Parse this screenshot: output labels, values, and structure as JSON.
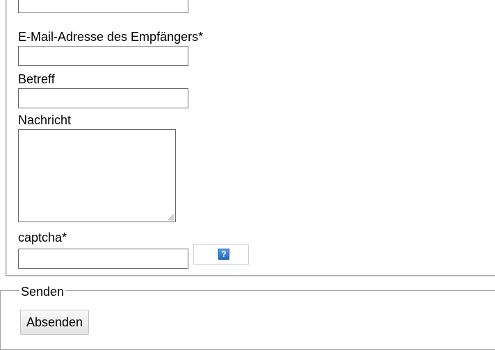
{
  "form": {
    "fields": {
      "recipient_email": {
        "label": "E-Mail-Adresse des Empfängers*",
        "value": ""
      },
      "subject": {
        "label": "Betreff",
        "value": ""
      },
      "message": {
        "label": "Nachricht",
        "value": ""
      },
      "captcha": {
        "label": "captcha*",
        "value": "",
        "help_icon_label": "?"
      }
    },
    "send_section": {
      "legend": "Senden",
      "submit_label": "Absenden"
    }
  }
}
